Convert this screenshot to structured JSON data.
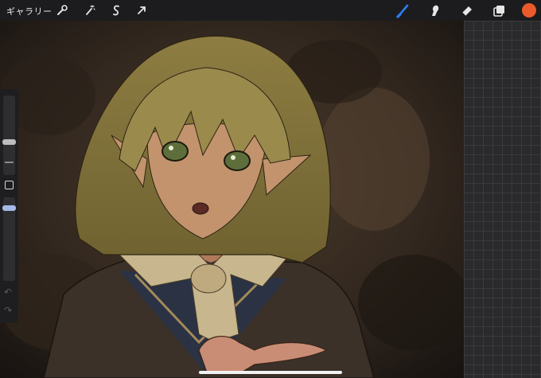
{
  "app": {
    "gallery_label": "ギャラリー"
  },
  "toolbar": {
    "left_tools": [
      {
        "icon": "wrench-icon"
      },
      {
        "icon": "magic-wand-icon"
      },
      {
        "icon": "selection-s-icon"
      },
      {
        "icon": "transform-arrow-icon"
      }
    ],
    "right_tools": [
      {
        "icon": "brush-icon",
        "active": true
      },
      {
        "icon": "smudge-icon"
      },
      {
        "icon": "eraser-icon"
      },
      {
        "icon": "layers-icon"
      }
    ],
    "current_color": "#ea5a2a",
    "active_color": "#2f7cf6"
  },
  "sidebar": {
    "controls": [
      "size-slider",
      "modify-button",
      "opacity-slider",
      "undo",
      "redo"
    ]
  }
}
